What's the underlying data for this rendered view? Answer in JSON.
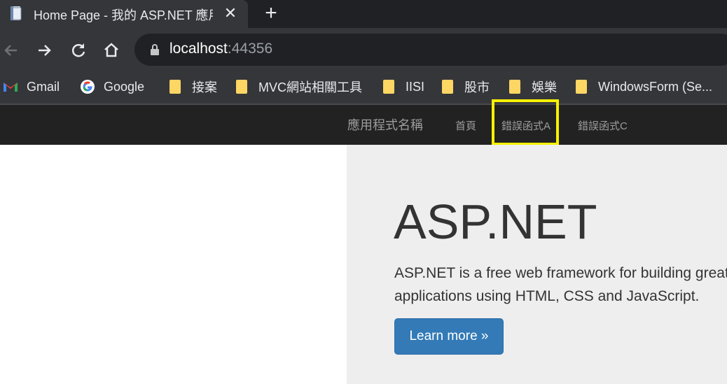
{
  "browser": {
    "tab": {
      "title": "Home Page - 我的 ASP.NET 應用程式"
    },
    "url": {
      "host": "localhost",
      "port": ":44356"
    },
    "bookmarks": [
      {
        "label": "Gmail",
        "icon": "gmail-icon"
      },
      {
        "label": "Google",
        "icon": "google-icon"
      },
      {
        "label": "接案",
        "icon": "folder-icon"
      },
      {
        "label": "MVC網站相關工具",
        "icon": "folder-icon"
      },
      {
        "label": "IISI",
        "icon": "folder-icon"
      },
      {
        "label": "股市",
        "icon": "folder-icon"
      },
      {
        "label": "娛樂",
        "icon": "folder-icon"
      },
      {
        "label": "WindowsForm (Se...",
        "icon": "folder-icon"
      }
    ]
  },
  "site": {
    "brand": "應用程式名稱",
    "nav": [
      {
        "label": "首頁"
      },
      {
        "label": "錯誤函式A"
      },
      {
        "label": "錯誤函式C"
      }
    ],
    "jumbotron": {
      "heading": "ASP.NET",
      "lead": "ASP.NET is a free web framework for building great Web sites and Web applications using HTML, CSS and JavaScript.",
      "button": "Learn more »"
    }
  },
  "colors": {
    "highlight": "#f6f000",
    "button": "#337ab7",
    "navbar": "#222222",
    "jumbotron": "#eeeeee"
  }
}
